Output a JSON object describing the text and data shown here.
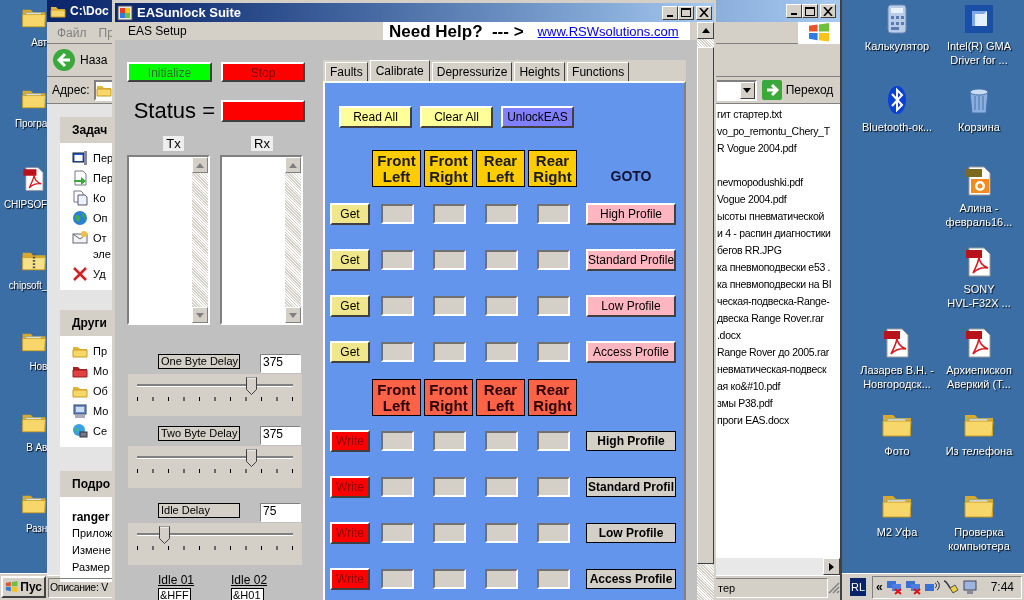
{
  "desktop_left": [
    {
      "label": "Авт",
      "kind": "folder"
    },
    {
      "label": "Програ",
      "kind": "folder"
    },
    {
      "label": "CHIPSOF",
      "kind": "pdf"
    },
    {
      "label": "chipsoft_",
      "kind": "zip"
    },
    {
      "label": "Нов",
      "kind": "folder"
    },
    {
      "label": "В Ав",
      "kind": "folder"
    },
    {
      "label": "Разн",
      "kind": "folder"
    }
  ],
  "desktop_right": [
    {
      "icons": [
        {
          "label": "Калькулятор",
          "kind": "calculator"
        },
        {
          "label": "Intel(R) GMA\nDriver for ...",
          "kind": "display"
        }
      ]
    },
    {
      "icons": [
        {
          "label": "Bluetooth-ок...",
          "kind": "bluetooth"
        },
        {
          "label": "Корзина",
          "kind": "recycle"
        }
      ]
    },
    {
      "icons": [
        {
          "label": "Алина -\nфевраль16...",
          "kind": "jpg"
        }
      ]
    },
    {
      "icons": [
        {
          "label": "SONY\nHVL-F32X ...",
          "kind": "pdf"
        }
      ]
    },
    {
      "icons": [
        {
          "label": "Лазарев В.Н. -\nНовгородск...",
          "kind": "pdf"
        },
        {
          "label": "Архиепископ\nАверкий (Т...",
          "kind": "pdf"
        }
      ]
    },
    {
      "icons": [
        {
          "label": "Фото",
          "kind": "folder"
        },
        {
          "label": "Из телефона",
          "kind": "folder"
        }
      ]
    },
    {
      "icons": [
        {
          "label": "M2 Уфа",
          "kind": "folder"
        },
        {
          "label": "Проверка\nкомпьютера",
          "kind": "folder"
        }
      ]
    }
  ],
  "explorer": {
    "title": "C:\\Doc",
    "menu": [
      "Файл",
      "Пр"
    ],
    "back": "Наза",
    "address_label": "Адрес:",
    "go": "Переход",
    "panels": [
      {
        "title": "Задач",
        "items": [
          {
            "label": "Пер",
            "kind": "window"
          },
          {
            "label": "Пер",
            "kind": "move"
          },
          {
            "label": "Ко",
            "kind": "copy"
          },
          {
            "label": "Оп",
            "kind": "globe"
          },
          {
            "label": "От\nэле",
            "kind": "mail"
          },
          {
            "label": "Уд",
            "kind": "delete"
          }
        ]
      },
      {
        "title": "Други",
        "items": [
          {
            "label": "Пр",
            "kind": "folder"
          },
          {
            "label": "Мо",
            "kind": "red-folder"
          },
          {
            "label": "Об",
            "kind": "folder"
          },
          {
            "label": "Мо",
            "kind": "computer"
          },
          {
            "label": "Се",
            "kind": "network"
          }
        ]
      }
    ],
    "details": {
      "title": "Подро",
      "name": "ranger",
      "lines": [
        "Прилож",
        "Измене",
        "Размер"
      ]
    },
    "files": [
      "гит стартер.txt",
      "vo_po_remontu_Chery_T",
      "R Vogue 2004.pdf",
      "nevmopodushki.pdf",
      "Vogue 2004.pdf",
      "ысоты пневматической",
      "и 4 - распин диагностики",
      "бегов RR.JPG",
      "ка пневмоподвески е53 .",
      "ка пневмоподвески на BI",
      "ческая-подвеска-Range-",
      "двеска Range Rover.rar",
      ".docx",
      "Range Rover до 2005.rar",
      "невматическая-подвеск",
      "ая ко&#10.pdf",
      "змы P38.pdf",
      "проги EAS.docx"
    ],
    "status_left": "Описание: V",
    "status_right": "тер"
  },
  "app": {
    "title": "EASunlock Suite",
    "menu": [
      "EAS Setup"
    ],
    "help_text": "Need Help?  --- >",
    "help_link": "www.RSWsolutions.com",
    "initialize": "Initialize",
    "stop": "Stop",
    "status_label": "Status =",
    "status_indicator": {
      "color": "#ff0000"
    },
    "tx_label": "Tx",
    "rx_label": "Rx",
    "sliders": [
      {
        "label": "One Byte Delay",
        "value": "375",
        "level": 0.73
      },
      {
        "label": "Two Byte Delay",
        "value": "375",
        "level": 0.73
      },
      {
        "label": "Idle Delay",
        "value": "75",
        "level": 0.17
      }
    ],
    "idle_fields": [
      {
        "label": "Idle 01",
        "value": "&HFF"
      },
      {
        "label": "Idle 02",
        "value": "&H01"
      }
    ],
    "tabs": [
      {
        "label": "Faults",
        "selected": false
      },
      {
        "label": "Calibrate",
        "selected": true
      },
      {
        "label": "Depressurize",
        "selected": false
      },
      {
        "label": "Heights",
        "selected": false
      },
      {
        "label": "Functions",
        "selected": false
      }
    ],
    "actions": [
      {
        "label": "Read All",
        "color": "#ffff99"
      },
      {
        "label": "Clear All",
        "color": "#ffff99"
      },
      {
        "label": "UnlockEAS",
        "color": "#8080ff"
      }
    ],
    "read_headers": [
      "Front Left",
      "Front Right",
      "Rear Left",
      "Rear Right"
    ],
    "goto_label": "GOTO",
    "read_rows": [
      {
        "button": "Get",
        "goto": "High Profile"
      },
      {
        "button": "Get",
        "goto": "Standard Profile"
      },
      {
        "button": "Get",
        "goto": "Low Profile"
      },
      {
        "button": "Get",
        "goto": "Access Profile"
      }
    ],
    "write_headers": [
      "Front Left",
      "Front Right",
      "Rear Left",
      "Rear Right"
    ],
    "write_rows": [
      {
        "button": "Write",
        "profile": "High Profile"
      },
      {
        "button": "Write",
        "profile": "Standard Profil"
      },
      {
        "button": "Write",
        "profile": "Low Profile"
      },
      {
        "button": "Write",
        "profile": "Access Profile"
      }
    ]
  },
  "taskbar": {
    "start": "Пус",
    "language": "RL",
    "chevron": "«",
    "clock": "7:44"
  }
}
